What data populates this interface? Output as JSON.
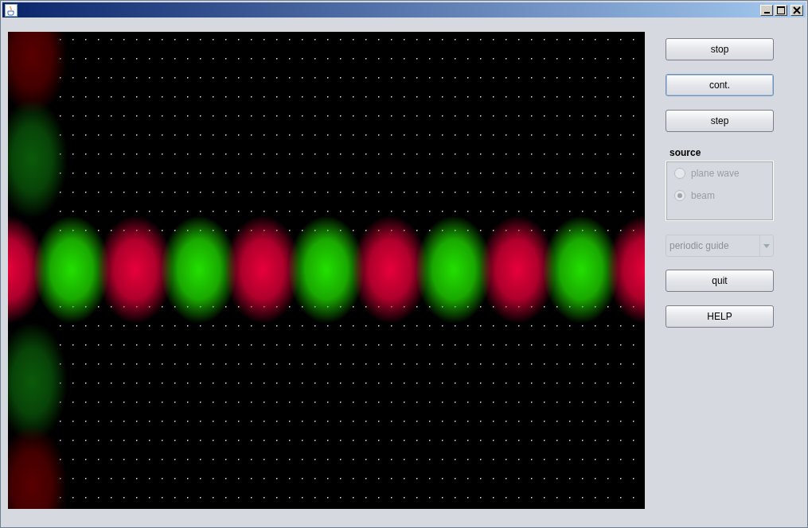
{
  "controls": [
    {
      "kind": "button",
      "label": "stop",
      "focused": false
    },
    {
      "kind": "button",
      "label": "cont.",
      "focused": true
    },
    {
      "kind": "button",
      "label": "step",
      "focused": false
    },
    {
      "kind": "radio-group",
      "label": "source",
      "disabled": true,
      "options": [
        {
          "label": "plane wave",
          "selected": false
        },
        {
          "label": "beam",
          "selected": true
        }
      ]
    },
    {
      "kind": "dropdown",
      "value": "periodic guide",
      "disabled": true
    },
    {
      "kind": "button",
      "label": "quit",
      "focused": false
    },
    {
      "kind": "button",
      "label": "HELP",
      "focused": false
    }
  ]
}
